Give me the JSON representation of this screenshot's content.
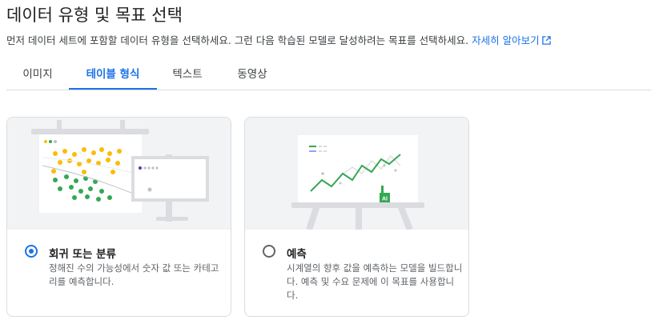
{
  "header": {
    "title": "데이터 유형 및 목표 선택",
    "description": "먼저 데이터 세트에 포함할 데이터 유형을 선택하세요. 그런 다음 학습된 모델로 달성하려는 목표를 선택하세요.",
    "learn_more": "자세히 알아보기",
    "learn_more_icon": "open-in-new-icon"
  },
  "tabs": [
    {
      "label": "이미지",
      "active": false
    },
    {
      "label": "테이블 형식",
      "active": true
    },
    {
      "label": "텍스트",
      "active": false
    },
    {
      "label": "동영상",
      "active": false
    }
  ],
  "cards": [
    {
      "title": "회귀 또는 분류",
      "description": "정해진 수의 가능성에서 숫자 값 또는 카테고리를 예측합니다.",
      "selected": true
    },
    {
      "title": "예측",
      "description": "시계열의 향후 값을 예측하는 모델을 빌드합니다. 예측 및 수요 문제에 이 목표를 사용합니다.",
      "selected": false
    }
  ],
  "colors": {
    "accent": "#1a73e8",
    "yellow": "#fbbc04",
    "green": "#34a853",
    "purple": "#9aa0f5"
  },
  "illustration": {
    "ai_badge": "AI"
  }
}
